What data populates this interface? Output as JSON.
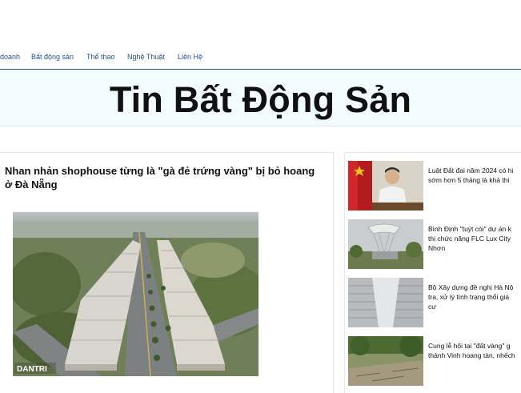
{
  "nav": {
    "items": [
      "doanh",
      "Bất động sản",
      "Thể thao",
      "Nghệ Thuật",
      "Liên Hệ"
    ]
  },
  "banner": {
    "title": "Tin Bất Động Sản"
  },
  "main_article": {
    "headline_line1": "Nhan nhản shophouse từng là \"gà đẻ trứng vàng\" bị bỏ hoang",
    "headline_line2": "ở Đà Nẵng",
    "photo_watermark": "DANTRI"
  },
  "sidebar": {
    "items": [
      {
        "line1": "Luật Đất đai năm 2024 có hi",
        "line2": "sớm hơn 5 tháng là khả thi"
      },
      {
        "line1": "Bình Định \"tuýt còi\" dự án k",
        "line2": "thị chức năng FLC Lux City",
        "line3": "Nhơn"
      },
      {
        "line1": "Bộ Xây dựng đề nghị Hà Nộ",
        "line2": "tra, xử lý tình trạng thổi giá",
        "line3": "cư"
      },
      {
        "line1": "Cung lễ hội tại \"đất vàng\" g",
        "line2": "thành Vinh hoang tàn, nhếch"
      }
    ]
  }
}
